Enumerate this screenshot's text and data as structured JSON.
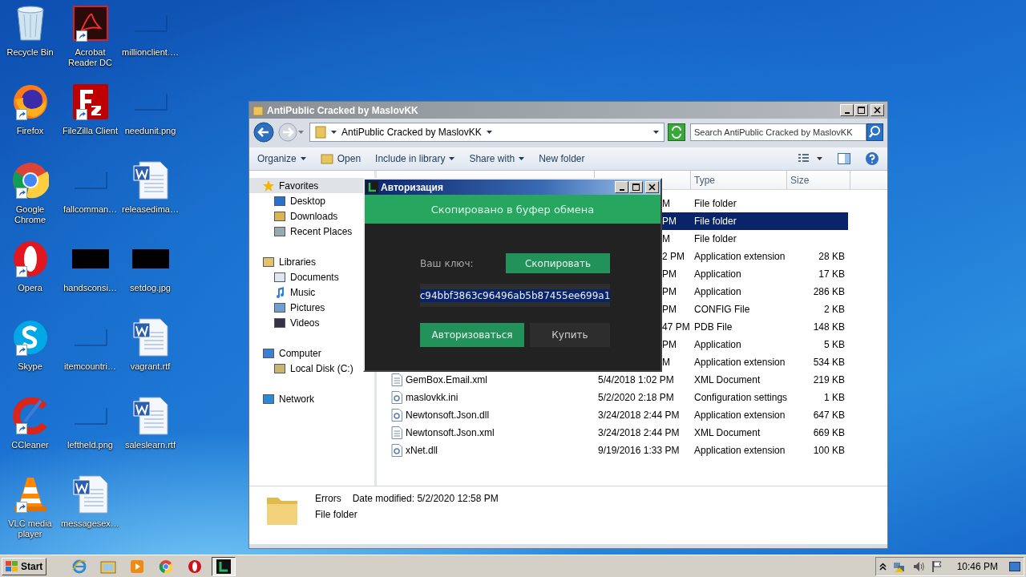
{
  "desktop": {
    "icons": [
      {
        "label": "Recycle Bin",
        "kind": "recycle",
        "shortcut": false
      },
      {
        "label": "Acrobat Reader DC",
        "kind": "acrobat",
        "shortcut": true
      },
      {
        "label": "millionclient.…",
        "kind": "blank",
        "shortcut": false
      },
      {
        "label": "Firefox",
        "kind": "firefox",
        "shortcut": true
      },
      {
        "label": "FileZilla Client",
        "kind": "filezilla",
        "shortcut": true
      },
      {
        "label": "needunit.png",
        "kind": "blank",
        "shortcut": false
      },
      {
        "label": "Google Chrome",
        "kind": "chrome",
        "shortcut": true
      },
      {
        "label": "fallcomman…",
        "kind": "blank",
        "shortcut": false
      },
      {
        "label": "releasedima…",
        "kind": "word",
        "shortcut": false
      },
      {
        "label": "Opera",
        "kind": "opera",
        "shortcut": true
      },
      {
        "label": "handsconsi…",
        "kind": "black",
        "shortcut": false
      },
      {
        "label": "setdog.jpg",
        "kind": "black",
        "shortcut": false
      },
      {
        "label": "Skype",
        "kind": "skype",
        "shortcut": true
      },
      {
        "label": "itemcountri…",
        "kind": "blank",
        "shortcut": false
      },
      {
        "label": "vagrant.rtf",
        "kind": "word",
        "shortcut": false
      },
      {
        "label": "CCleaner",
        "kind": "ccleaner",
        "shortcut": true
      },
      {
        "label": "leftheld.png",
        "kind": "blank",
        "shortcut": false
      },
      {
        "label": "saleslearn.rtf",
        "kind": "word",
        "shortcut": false
      },
      {
        "label": "VLC media player",
        "kind": "vlc",
        "shortcut": true
      },
      {
        "label": "messagesex…",
        "kind": "word",
        "shortcut": false
      }
    ]
  },
  "explorer": {
    "title": "AntiPublic Cracked by MaslovKK",
    "address": "AntiPublic Cracked by MaslovKK",
    "search": {
      "placeholder": "Search AntiPublic Cracked by MaslovKK"
    },
    "toolbar": [
      {
        "label": "Organize",
        "kind": "dropdown"
      },
      {
        "label": "Open",
        "kind": "open"
      },
      {
        "label": "Include in library",
        "kind": "dropdown"
      },
      {
        "label": "Share with",
        "kind": "dropdown"
      },
      {
        "label": "New folder",
        "kind": "plain"
      }
    ],
    "nav": [
      {
        "label": "Favorites",
        "kind": "star",
        "selected": true,
        "children": [
          {
            "label": "Desktop",
            "kind": "desktop",
            "selected": false
          },
          {
            "label": "Downloads",
            "kind": "downloads",
            "selected": false
          },
          {
            "label": "Recent Places",
            "kind": "recent",
            "selected": false
          }
        ]
      },
      {
        "label": "Libraries",
        "kind": "library",
        "selected": false,
        "children": [
          {
            "label": "Documents",
            "kind": "document",
            "selected": false
          },
          {
            "label": "Music",
            "kind": "music",
            "selected": false
          },
          {
            "label": "Pictures",
            "kind": "pictures",
            "selected": false
          },
          {
            "label": "Videos",
            "kind": "videos",
            "selected": false
          }
        ]
      },
      {
        "label": "Computer",
        "kind": "computer",
        "selected": false,
        "children": [
          {
            "label": "Local Disk (C:)",
            "kind": "disk",
            "selected": false
          }
        ]
      },
      {
        "label": "Network",
        "kind": "network",
        "selected": false
      }
    ],
    "columns": [
      "Type",
      "Size"
    ],
    "rows": [
      {
        "date": "M",
        "type": "File folder",
        "selected": false
      },
      {
        "date": "PM",
        "type": "File folder",
        "selected": true
      },
      {
        "date": "M",
        "type": "File folder",
        "selected": false
      },
      {
        "date": "2 PM",
        "type": "Application extension",
        "size": "28 KB",
        "selected": false
      },
      {
        "date": "PM",
        "type": "Application",
        "size": "17 KB",
        "selected": false
      },
      {
        "date": "PM",
        "type": "Application",
        "size": "286 KB",
        "selected": false
      },
      {
        "date": "PM",
        "type": "CONFIG File",
        "size": "2 KB",
        "selected": false
      },
      {
        "date": "47 PM",
        "type": "PDB File",
        "size": "148 KB",
        "selected": false
      },
      {
        "date": "PM",
        "type": "Application",
        "size": "5 KB",
        "selected": false
      },
      {
        "date": "M",
        "type": "Application extension",
        "size": "534 KB",
        "selected": false
      },
      {
        "name": "GemBox.Email.xml",
        "kind": "xml",
        "date": "5/4/2018 1:02 PM",
        "type": "XML Document",
        "size": "219 KB",
        "selected": false
      },
      {
        "name": "maslovkk.ini",
        "kind": "ini",
        "date": "5/2/2020 2:18 PM",
        "type": "Configuration settings",
        "size": "1 KB",
        "selected": false
      },
      {
        "name": "Newtonsoft.Json.dll",
        "kind": "dll",
        "date": "3/24/2018 2:44 PM",
        "type": "Application extension",
        "size": "647 KB",
        "selected": false
      },
      {
        "name": "Newtonsoft.Json.xml",
        "kind": "xml",
        "date": "3/24/2018 2:44 PM",
        "type": "XML Document",
        "size": "669 KB",
        "selected": false
      },
      {
        "name": "xNet.dll",
        "kind": "dll",
        "date": "9/19/2016 1:33 PM",
        "type": "Application extension",
        "size": "100 KB",
        "selected": false
      }
    ],
    "details": {
      "name": "Errors",
      "modified": "Date modified: 5/2/2020 12:58 PM",
      "type": "File folder"
    }
  },
  "dialog": {
    "title": "Авторизация",
    "banner": "Скопировано в буфер обмена",
    "key_label": "Ваш ключ:",
    "copy_button": "Скопировать",
    "key": "c94bbf3863c96496ab5b87455ee699a1",
    "buttons": [
      {
        "label": "Авторизоваться",
        "kind": "primary"
      },
      {
        "label": "Купить",
        "kind": "secondary"
      }
    ]
  },
  "taskbar": {
    "start": "Start",
    "apps": [
      {
        "kind": "ie",
        "active": false
      },
      {
        "kind": "explorer",
        "active": false
      },
      {
        "kind": "media",
        "active": false
      },
      {
        "kind": "chrome",
        "active": false
      },
      {
        "kind": "opera",
        "active": false
      },
      {
        "kind": "app",
        "active": true
      }
    ],
    "time": "10:46 PM"
  }
}
